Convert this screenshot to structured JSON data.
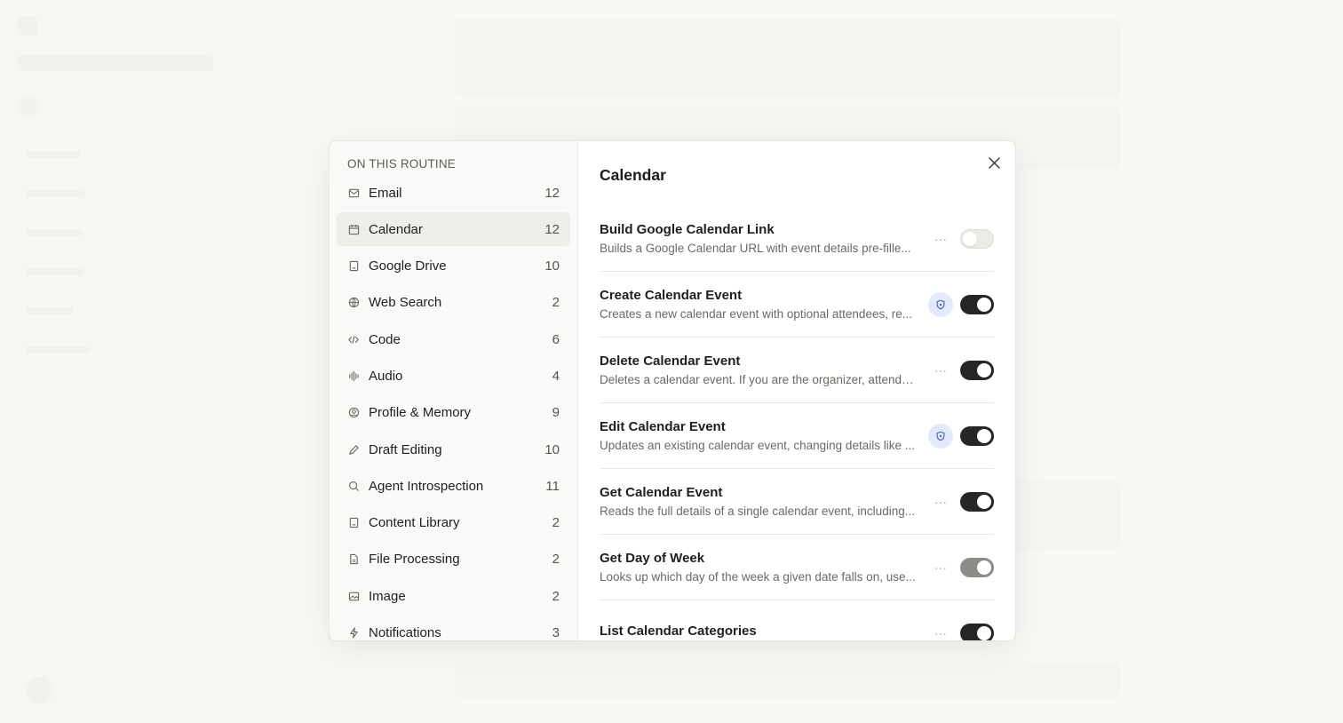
{
  "colors": {
    "accent": "#262626",
    "shield": "#3b5fc9",
    "shield_bg": "#e3eafc",
    "active_nav": "#eeedea"
  },
  "sidebar": {
    "title": "ON THIS ROUTINE",
    "items": [
      {
        "label": "Email",
        "count": "12",
        "icon": "mail-icon"
      },
      {
        "label": "Calendar",
        "count": "12",
        "icon": "calendar-icon",
        "active": true
      },
      {
        "label": "Google Drive",
        "count": "10",
        "icon": "drive-icon"
      },
      {
        "label": "Web Search",
        "count": "2",
        "icon": "globe-icon"
      },
      {
        "label": "Code",
        "count": "6",
        "icon": "code-icon"
      },
      {
        "label": "Audio",
        "count": "4",
        "icon": "audio-icon"
      },
      {
        "label": "Profile & Memory",
        "count": "9",
        "icon": "profile-icon"
      },
      {
        "label": "Draft Editing",
        "count": "10",
        "icon": "pencil-icon"
      },
      {
        "label": "Agent Introspection",
        "count": "11",
        "icon": "search-icon"
      },
      {
        "label": "Content Library",
        "count": "2",
        "icon": "library-icon"
      },
      {
        "label": "File Processing",
        "count": "2",
        "icon": "file-icon"
      },
      {
        "label": "Image",
        "count": "2",
        "icon": "image-icon"
      },
      {
        "label": "Notifications",
        "count": "3",
        "icon": "bolt-icon"
      }
    ]
  },
  "panel": {
    "title": "Calendar",
    "tools": [
      {
        "name": "Build Google Calendar Link",
        "desc": "Builds a Google Calendar URL with event details pre-fille...",
        "action": "more",
        "toggle": "off"
      },
      {
        "name": "Create Calendar Event",
        "desc": "Creates a new calendar event with optional attendees, re...",
        "action": "shield",
        "toggle": "on"
      },
      {
        "name": "Delete Calendar Event",
        "desc": "Deletes a calendar event. If you are the organizer, attende...",
        "action": "more",
        "toggle": "on"
      },
      {
        "name": "Edit Calendar Event",
        "desc": "Updates an existing calendar event, changing details like ...",
        "action": "shield",
        "toggle": "on"
      },
      {
        "name": "Get Calendar Event",
        "desc": "Reads the full details of a single calendar event, including...",
        "action": "more",
        "toggle": "on"
      },
      {
        "name": "Get Day of Week",
        "desc": "Looks up which day of the week a given date falls on, use...",
        "action": "more",
        "toggle": "dim"
      },
      {
        "name": "List Calendar Categories",
        "desc": "",
        "action": "more",
        "toggle": "on"
      }
    ]
  }
}
